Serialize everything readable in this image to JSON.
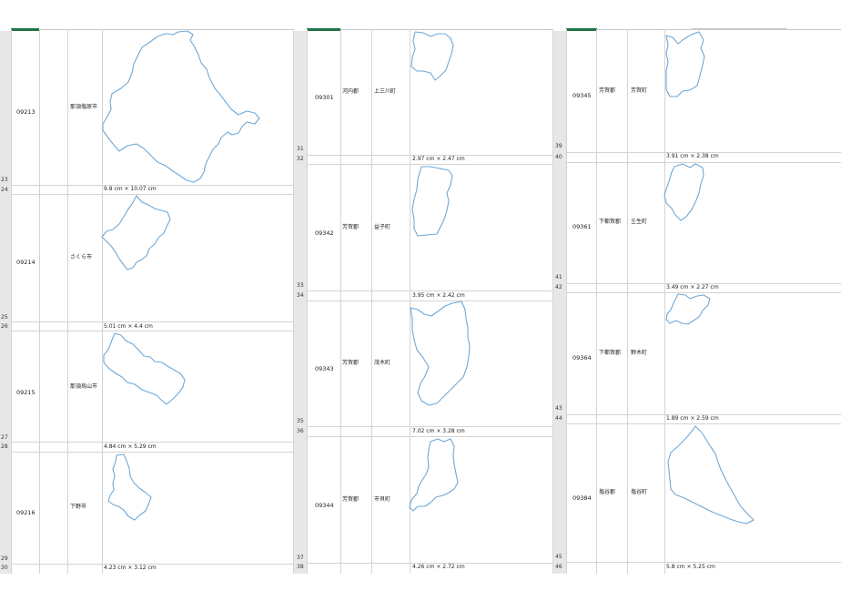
{
  "sheet": {
    "panels": [
      {
        "rows": [
          {
            "code": "09213",
            "city": "那須塩原市",
            "pref_district": "",
            "top_row": "23",
            "bottom_row": "24",
            "size": "9.8 cm × 10.07 cm"
          },
          {
            "code": "09214",
            "city": "さくら市",
            "pref_district": "",
            "top_row": "25",
            "bottom_row": "26",
            "size": "5.01 cm × 4.4 cm"
          },
          {
            "code": "09215",
            "city": "那須烏山市",
            "pref_district": "",
            "top_row": "27",
            "bottom_row": "28",
            "size": "4.84 cm × 5.29 cm"
          },
          {
            "code": "09216",
            "city": "下野市",
            "pref_district": "",
            "top_row": "29",
            "bottom_row": "30",
            "size": "4.23 cm × 3.12 cm"
          }
        ]
      },
      {
        "rows": [
          {
            "code": "09301",
            "city": "上三川町",
            "pref_district": "河内郡",
            "top_row": "31",
            "bottom_row": "32",
            "size": "2.97 cm × 2.47 cm"
          },
          {
            "code": "09342",
            "city": "益子町",
            "pref_district": "芳賀郡",
            "top_row": "33",
            "bottom_row": "34",
            "size": "3.95 cm × 2.42 cm"
          },
          {
            "code": "09343",
            "city": "茂木町",
            "pref_district": "芳賀郡",
            "top_row": "35",
            "bottom_row": "36",
            "size": "7.02 cm × 3.28 cm"
          },
          {
            "code": "09344",
            "city": "市貝町",
            "pref_district": "芳賀郡",
            "top_row": "37",
            "bottom_row": "38",
            "size": "4.26 cm × 2.72 cm"
          }
        ]
      },
      {
        "rows": [
          {
            "code": "09345",
            "city": "芳賀町",
            "pref_district": "芳賀郡",
            "top_row": "39",
            "bottom_row": "40",
            "size": "3.91 cm × 2.38 cm"
          },
          {
            "code": "09361",
            "city": "壬生町",
            "pref_district": "下都賀郡",
            "top_row": "41",
            "bottom_row": "42",
            "size": "3.49 cm × 2.27 cm"
          },
          {
            "code": "09364",
            "city": "野木町",
            "pref_district": "下都賀郡",
            "top_row": "43",
            "bottom_row": "44",
            "size": "1.89 cm × 2.59 cm"
          },
          {
            "code": "09384",
            "city": "塩谷町",
            "pref_district": "塩谷郡",
            "top_row": "45",
            "bottom_row": "46",
            "size": "5.8 cm × 5.25 cm"
          }
        ]
      }
    ],
    "colors": {
      "outline": "#6fa8d6",
      "grid": "#d4d4d4",
      "gutter": "#e7e7e7",
      "accent": "#217346"
    }
  }
}
